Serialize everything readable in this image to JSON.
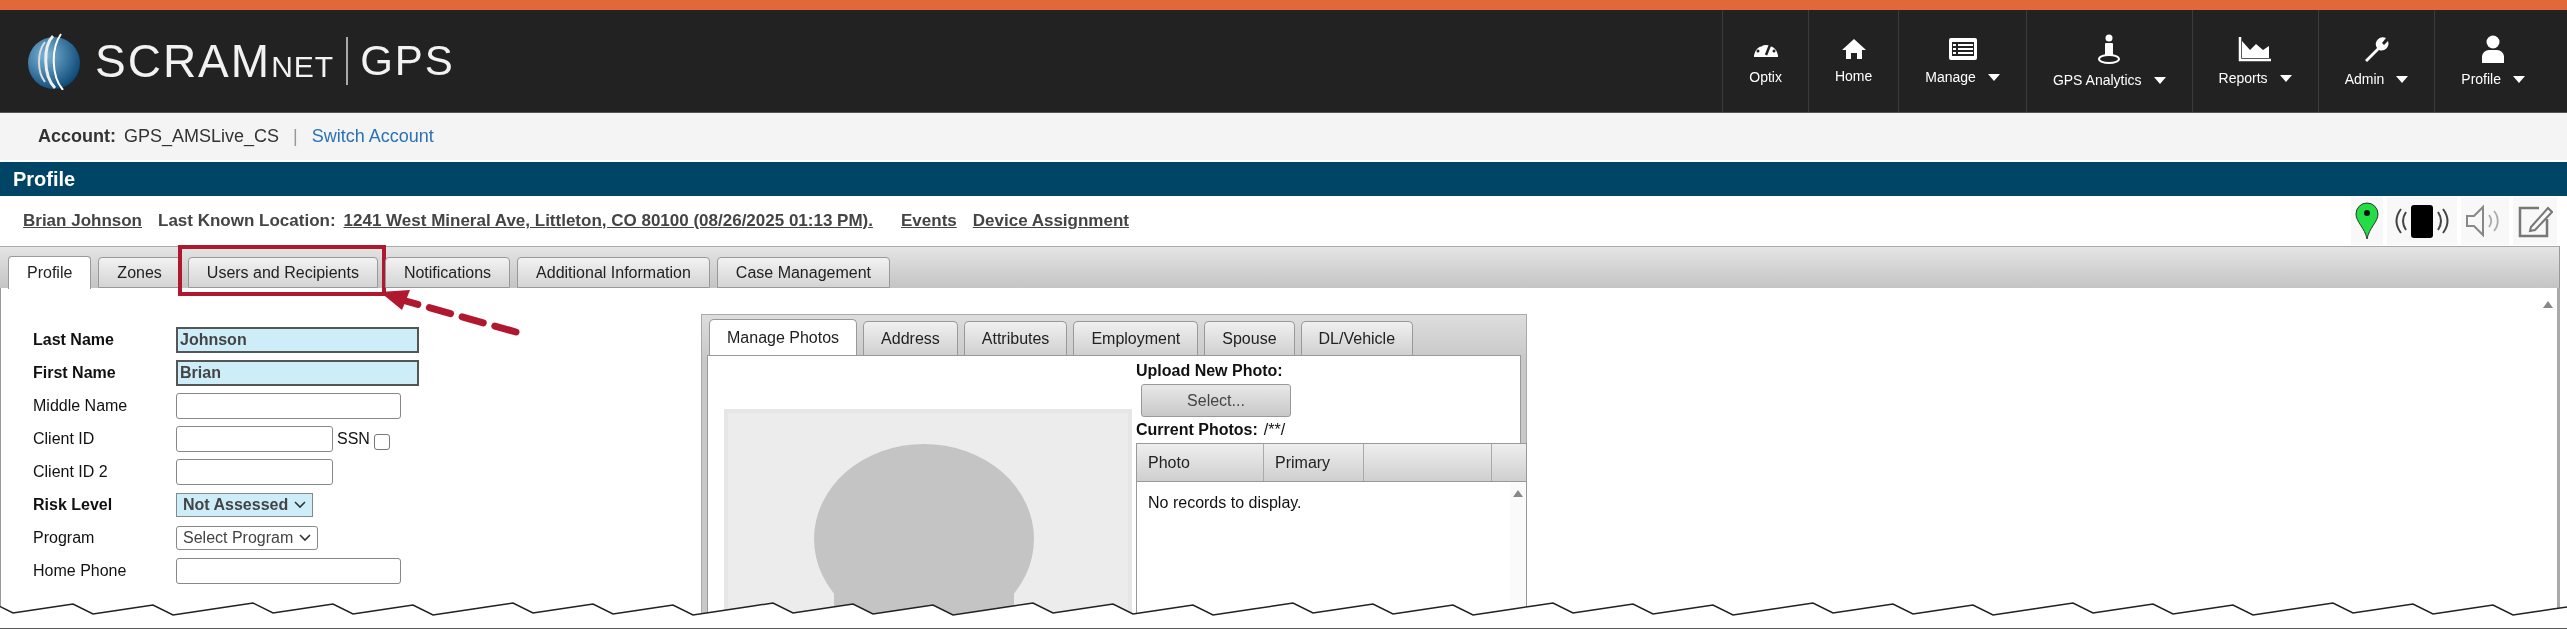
{
  "header": {
    "logo": {
      "brand": "SCRAM",
      "suffix": "NET",
      "product": "GPS"
    },
    "nav": [
      {
        "label": "Optix",
        "dropdown": false
      },
      {
        "label": "Home",
        "dropdown": false
      },
      {
        "label": "Manage",
        "dropdown": true
      },
      {
        "label": "GPS Analytics",
        "dropdown": true
      },
      {
        "label": "Reports",
        "dropdown": true
      },
      {
        "label": "Admin",
        "dropdown": true
      },
      {
        "label": "Profile",
        "dropdown": true
      }
    ]
  },
  "account_bar": {
    "label": "Account:",
    "value": "GPS_AMSLive_CS",
    "separator": "|",
    "link": "Switch Account"
  },
  "page_title": "Profile",
  "subject": {
    "name": "Brian Johnson",
    "location_label": "Last Known Location:",
    "location": "1241 West Mineral Ave, Littleton, CO 80100 (08/26/2025 01:13 PM).",
    "links": [
      "Events",
      "Device Assignment"
    ]
  },
  "tabs": [
    {
      "label": "Profile",
      "selected": true,
      "highlighted": false
    },
    {
      "label": "Zones",
      "selected": false,
      "highlighted": false
    },
    {
      "label": "Users and Recipients",
      "selected": false,
      "highlighted": true
    },
    {
      "label": "Notifications",
      "selected": false,
      "highlighted": false
    },
    {
      "label": "Additional Information",
      "selected": false,
      "highlighted": false
    },
    {
      "label": "Case Management",
      "selected": false,
      "highlighted": false
    }
  ],
  "form": {
    "fields": [
      {
        "label": "Last Name",
        "kind": "text",
        "required": true,
        "value": "Johnson"
      },
      {
        "label": "First Name",
        "kind": "text",
        "required": true,
        "value": "Brian"
      },
      {
        "label": "Middle Name",
        "kind": "text",
        "required": false
      },
      {
        "label": "Client ID",
        "kind": "id",
        "required": false,
        "checkbox": {
          "label": "SSN",
          "checked": false
        }
      },
      {
        "label": "Client ID 2",
        "kind": "id",
        "required": false
      },
      {
        "label": "Risk Level",
        "kind": "select",
        "required": true,
        "value": "Not Assessed"
      },
      {
        "label": "Program",
        "kind": "select",
        "required": false,
        "value": "Select Program"
      },
      {
        "label": "Home Phone",
        "kind": "text",
        "required": false
      }
    ]
  },
  "photo_panel": {
    "tabs": [
      {
        "label": "Manage Photos",
        "selected": true
      },
      {
        "label": "Address",
        "selected": false
      },
      {
        "label": "Attributes",
        "selected": false
      },
      {
        "label": "Employment",
        "selected": false
      },
      {
        "label": "Spouse",
        "selected": false
      },
      {
        "label": "DL/Vehicle",
        "selected": false
      }
    ],
    "upload_label": "Upload New Photo:",
    "select_button": "Select...",
    "current_label": "Current Photos:",
    "current_value": "/**/",
    "table": {
      "columns": [
        "Photo",
        "Primary"
      ],
      "empty_message": "No records to display."
    }
  }
}
